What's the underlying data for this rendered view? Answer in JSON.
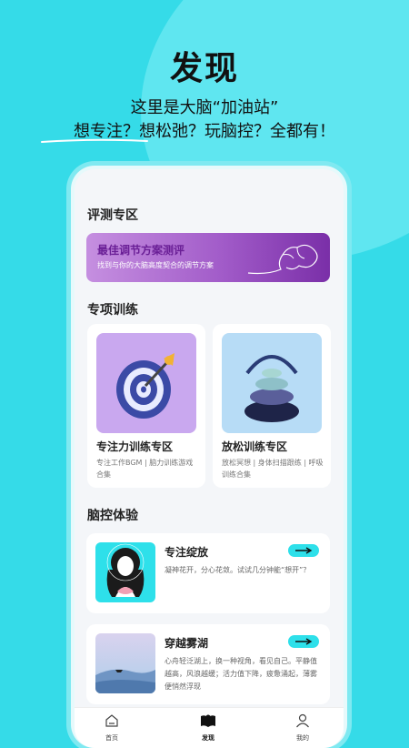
{
  "hero": {
    "title": "发现",
    "line1": "这里是大脑“加油站”",
    "line2": "想专注？想松弛？玩脑控？全都有！"
  },
  "sections": {
    "evaluation_title": "评测专区",
    "training_title": "专项训练",
    "experience_title": "脑控体验"
  },
  "evaluation_banner": {
    "title": "最佳调节方案测评",
    "subtitle": "找到与你的大脑高度契合的调节方案"
  },
  "training_cards": [
    {
      "title": "专注力训练专区",
      "desc": "专注工作BGM | 脑力训练游戏合集"
    },
    {
      "title": "放松训练专区",
      "desc": "放松冥想 | 身体扫描跟练 | 呼吸训练合集"
    }
  ],
  "experience_cards": [
    {
      "title": "专注绽放",
      "desc": "凝神花开，分心花敛。试试几分钟能“想开”？"
    },
    {
      "title": "穿越雾湖",
      "desc": "心舟轻泛湖上，换一种视角，看见自己。平静值越高，风浪越缓；活力值下降，疲惫涌起，薄雾便悄然浮现"
    }
  ],
  "tabbar": [
    {
      "label": "首页",
      "icon": "home-icon"
    },
    {
      "label": "发现",
      "icon": "book-icon"
    },
    {
      "label": "我的",
      "icon": "user-icon"
    }
  ],
  "colors": {
    "background": "#35dbe8",
    "accent": "#2ee0ea",
    "banner_purple": "#a25cc9"
  }
}
